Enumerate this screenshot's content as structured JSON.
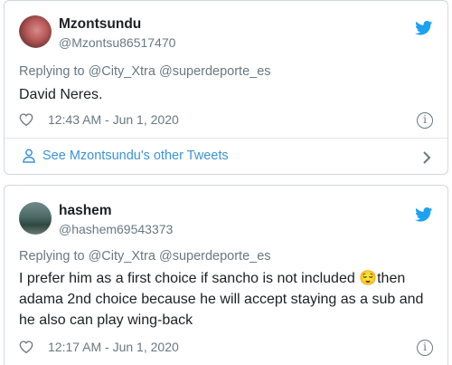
{
  "tweets": [
    {
      "name": "Mzontsundu",
      "handle": "@Mzontsu86517470",
      "reply_prefix": "Replying to",
      "reply_to_1": "@City_Xtra",
      "reply_to_2": "@superdeporte_es",
      "text": "David Neres.",
      "timestamp": "12:43 AM - Jun 1, 2020",
      "see_more": "See Mzontsundu's other Tweets"
    },
    {
      "name": "hashem",
      "handle": "@hashem69543373",
      "reply_prefix": "Replying to",
      "reply_to_1": "@City_Xtra",
      "reply_to_2": "@superdeporte_es",
      "text_line1_a": "I prefer him as a first choice if sancho is not included",
      "emoji": "😌",
      "text_line1_b": "then",
      "text_line2": "adama 2nd choice because he will accept staying as a sub and",
      "text_line3": "he also can play wing-back",
      "timestamp": "12:17 AM - Jun 1, 2020"
    }
  ],
  "colors": {
    "twitter_blue": "#1da1f2",
    "link_blue": "#3b94d9",
    "muted": "#697882"
  },
  "icons": {
    "bird": "twitter-bird-icon",
    "heart": "heart-icon",
    "info": "info-icon",
    "person": "person-icon",
    "chevron": "chevron-right-icon"
  }
}
